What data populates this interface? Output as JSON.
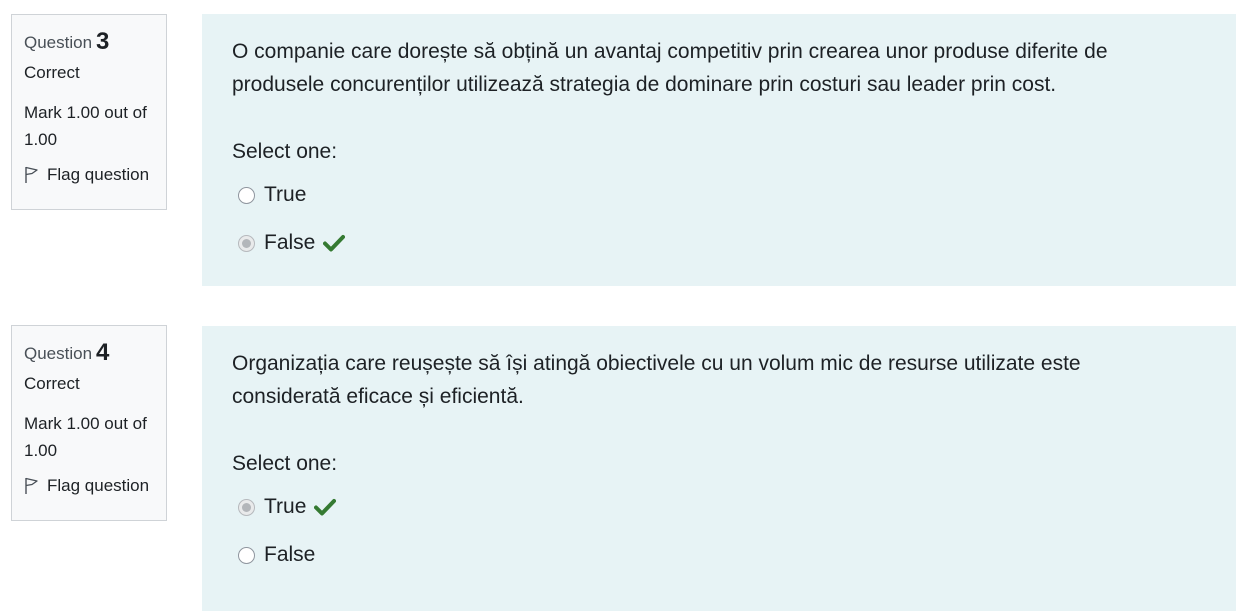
{
  "questions": [
    {
      "label": "Question",
      "number": "3",
      "state": "Correct",
      "grade": "Mark 1.00 out of 1.00",
      "flag_label": "Flag question",
      "text": "O companie care dorește să obțină un avantaj competitiv prin crearea unor produse diferite de produsele concurenților utilizează strategia de dominare prin costuri sau leader prin cost.",
      "prompt": "Select one:",
      "options": [
        {
          "label": "True",
          "selected": false,
          "correct": false
        },
        {
          "label": "False",
          "selected": true,
          "correct": true
        }
      ]
    },
    {
      "label": "Question",
      "number": "4",
      "state": "Correct",
      "grade": "Mark 1.00 out of 1.00",
      "flag_label": "Flag question",
      "text": "Organizația care reușește să își atingă obiectivele cu un volum mic de resurse utilizate este considerată eficace și eficientă.",
      "prompt": "Select one:",
      "options": [
        {
          "label": "True",
          "selected": true,
          "correct": true
        },
        {
          "label": "False",
          "selected": false,
          "correct": false
        }
      ]
    }
  ],
  "colors": {
    "content_bg": "#e7f3f5",
    "info_bg": "#f8f9fa",
    "correct_check": "#357a32"
  },
  "icons": {
    "flag": "flag-icon",
    "correct": "check-icon"
  }
}
